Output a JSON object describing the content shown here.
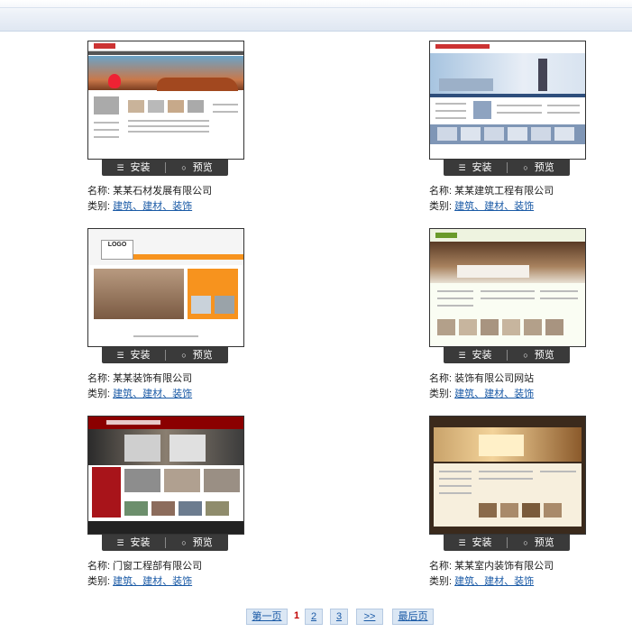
{
  "buttons": {
    "install_label": "安装",
    "preview_label": "预览"
  },
  "labels": {
    "name_prefix": "名称: ",
    "category_prefix": "类别: "
  },
  "templates": [
    {
      "name": "某某石材发展有限公司",
      "category": "建筑、建材、装饰"
    },
    {
      "name": "某某建筑工程有限公司",
      "category": "建筑、建材、装饰"
    },
    {
      "name": "某某装饰有限公司",
      "category": "建筑、建材、装饰"
    },
    {
      "name": "装饰有限公司网站",
      "category": "建筑、建材、装饰"
    },
    {
      "name": "门窗工程部有限公司",
      "category": "建筑、建材、装饰"
    },
    {
      "name": "某某室内装饰有限公司",
      "category": "建筑、建材、装饰"
    }
  ],
  "thumbnail_text": {
    "t3_logo": "LOGO"
  },
  "pagination": {
    "first": "第一页",
    "current": "1",
    "page2": "2",
    "page3": "3",
    "next": ">>",
    "last": "最后页"
  },
  "colors": {
    "link": "#1a5aa6",
    "current_page": "#c00000",
    "button_bar": "#3a3a3a"
  }
}
